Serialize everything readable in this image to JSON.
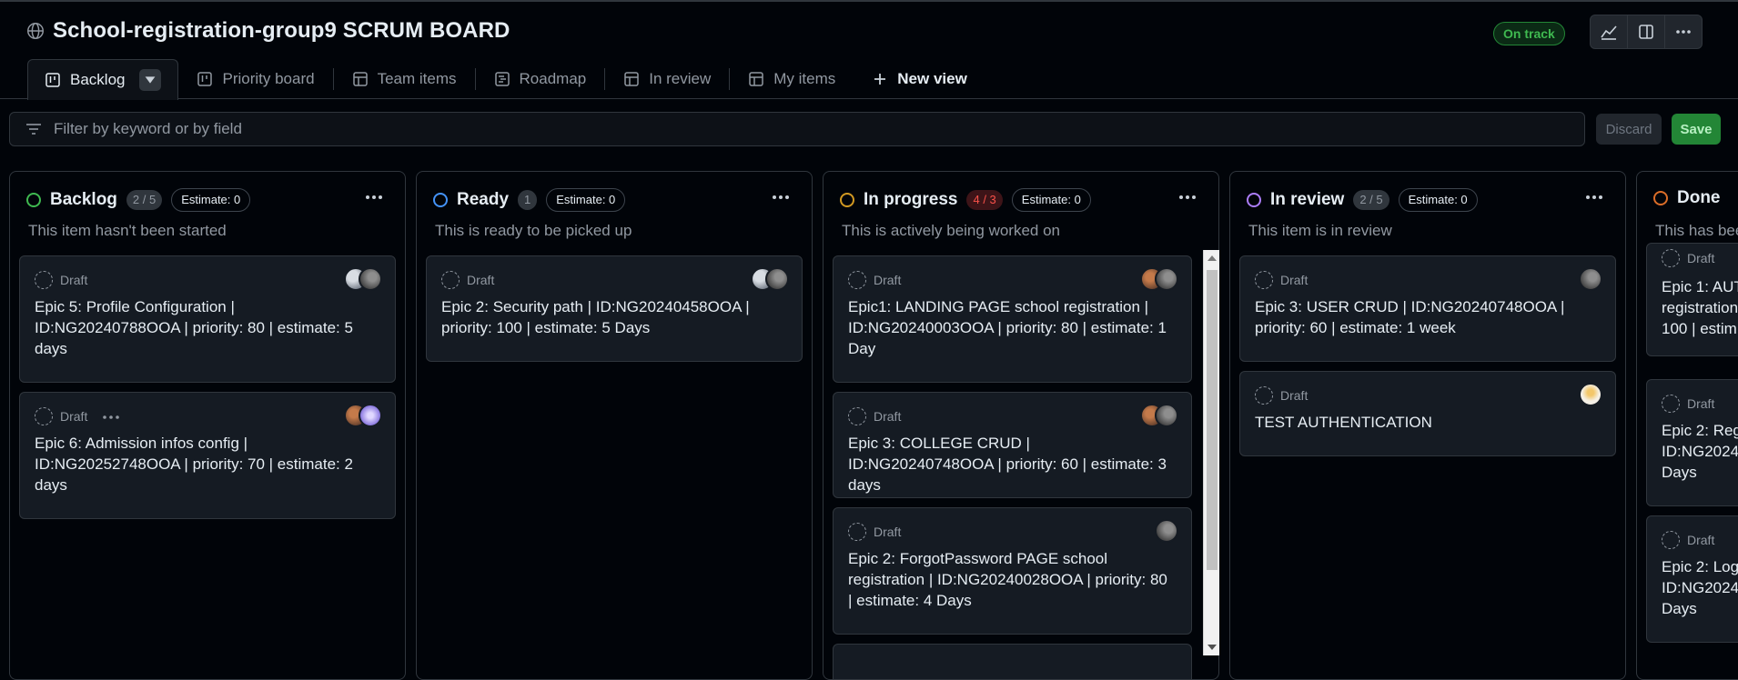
{
  "project": {
    "title": "School-registration-group9 SCRUM BOARD",
    "status_badge": "On track"
  },
  "header_buttons": [
    "insights-icon",
    "side-panel-icon",
    "more-options-icon"
  ],
  "tabs": [
    {
      "label": "Backlog",
      "icon": "board-icon"
    },
    {
      "label": "Priority board",
      "icon": "board-icon"
    },
    {
      "label": "Team items",
      "icon": "table-icon"
    },
    {
      "label": "Roadmap",
      "icon": "roadmap-icon"
    },
    {
      "label": "In review",
      "icon": "table-icon"
    },
    {
      "label": "My items",
      "icon": "table-icon"
    },
    {
      "label": "New view",
      "icon": "plus-icon"
    }
  ],
  "filter": {
    "placeholder": "Filter by keyword or by field"
  },
  "actions": {
    "discard": "Discard",
    "save": "Save"
  },
  "columns": [
    {
      "name": "Backlog",
      "count": "2 / 5",
      "estimate": "Estimate: 0",
      "description": "This item hasn't been started",
      "color": "#3fb950",
      "cards": [
        {
          "status": "Draft",
          "text": "Epic 5: Profile Configuration | ID:NG20240788OOA | priority: 80 | estimate: 5 days"
        },
        {
          "status": "Draft",
          "text": "Epic 6: Admission infos config | ID:NG20252748OOA | priority: 70 | estimate: 2 days"
        }
      ]
    },
    {
      "name": "Ready",
      "count": "1",
      "estimate": "Estimate: 0",
      "description": "This is ready to be picked up",
      "color": "#4493f8",
      "cards": [
        {
          "status": "Draft",
          "text": "Epic 2: Security path | ID:NG20240458OOA | priority: 100 | estimate: 5 Days"
        }
      ]
    },
    {
      "name": "In progress",
      "count": "4 / 3",
      "estimate": "Estimate: 0",
      "description": "This is actively being worked on",
      "color": "#d29922",
      "cards": [
        {
          "status": "Draft",
          "text": "Epic1: LANDING PAGE school registration | ID:NG20240003OOA | priority: 80 | estimate: 1 Day"
        },
        {
          "status": "Draft",
          "text": "Epic 3: COLLEGE CRUD | ID:NG20240748OOA | priority: 60 | estimate: 3 days"
        },
        {
          "status": "Draft",
          "text": "Epic 2: ForgotPassword PAGE school registration | ID:NG20240028OOA | priority: 80 | estimate: 4 Days"
        }
      ]
    },
    {
      "name": "In review",
      "count": "2 / 5",
      "estimate": "Estimate: 0",
      "description": "This item is in review",
      "color": "#ab7df8",
      "cards": [
        {
          "status": "Draft",
          "text": "Epic 3: USER CRUD | ID:NG20240748OOA | priority: 60 | estimate: 1 week"
        },
        {
          "status": "Draft",
          "text": "TEST AUTHENTICATION"
        }
      ]
    },
    {
      "name": "Done",
      "description": "This has bee",
      "color": "#db6d28",
      "cards": [
        {
          "status": "Draft",
          "text": "Epic 1: AUT registration 100 | estim"
        },
        {
          "status": "Draft",
          "text": "Epic 2: Reg ID:NG2024 Days"
        },
        {
          "status": "Draft",
          "text": "Epic 2: Log ID:NG2024 Days"
        }
      ]
    }
  ]
}
